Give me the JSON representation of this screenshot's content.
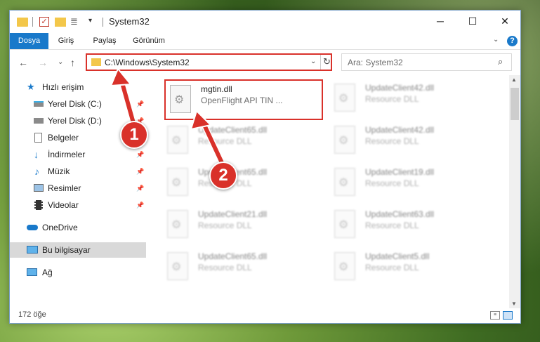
{
  "window": {
    "title": "System32",
    "min_glyph": "─",
    "max_glyph": "☐",
    "close_glyph": "✕"
  },
  "ribbon": {
    "tabs": [
      "Dosya",
      "Giriş",
      "Paylaş",
      "Görünüm"
    ],
    "help_glyph": "?"
  },
  "navbar": {
    "address": "C:\\Windows\\System32",
    "search_placeholder": "Ara: System32"
  },
  "sidebar": {
    "items": [
      {
        "label": "Hızlı erişim",
        "icon": "star-icon",
        "pinned": false
      },
      {
        "label": "Yerel Disk (C:)",
        "icon": "drive-icon",
        "pinned": true
      },
      {
        "label": "Yerel Disk (D:)",
        "icon": "drive-icon",
        "pinned": true
      },
      {
        "label": "Belgeler",
        "icon": "document-icon",
        "pinned": true
      },
      {
        "label": "İndirmeler",
        "icon": "download-icon",
        "pinned": true
      },
      {
        "label": "Müzik",
        "icon": "music-icon",
        "pinned": true
      },
      {
        "label": "Resimler",
        "icon": "pictures-icon",
        "pinned": true
      },
      {
        "label": "Videolar",
        "icon": "video-icon",
        "pinned": true
      },
      {
        "label": "OneDrive",
        "icon": "cloud-icon",
        "pinned": false
      },
      {
        "label": "Bu bilgisayar",
        "icon": "computer-icon",
        "pinned": false,
        "selected": true
      },
      {
        "label": "Ağ",
        "icon": "network-icon",
        "pinned": false
      }
    ]
  },
  "files": [
    {
      "name": "mgtin.dll",
      "desc": "OpenFlight API TIN ...",
      "highlight": true
    },
    {
      "name": "UpdateClient42.dll",
      "desc": "Resource DLL"
    },
    {
      "name": "UpdateClient65.dll",
      "desc": "Resource DLL"
    },
    {
      "name": "UpdateClient42.dll",
      "desc": "Resource DLL"
    },
    {
      "name": "UpdateClient65.dll",
      "desc": "Resource DLL"
    },
    {
      "name": "UpdateClient19.dll",
      "desc": "Resource DLL"
    },
    {
      "name": "UpdateClient21.dll",
      "desc": "Resource DLL"
    },
    {
      "name": "UpdateClient63.dll",
      "desc": "Resource DLL"
    },
    {
      "name": "UpdateClient65.dll",
      "desc": "Resource DLL"
    },
    {
      "name": "UpdateClient5.dll",
      "desc": "Resource DLL"
    }
  ],
  "status": {
    "count": "172 öğe"
  },
  "callouts": [
    "1",
    "2"
  ],
  "colors": {
    "accent": "#1979ca",
    "highlight_red": "#d9312a"
  }
}
